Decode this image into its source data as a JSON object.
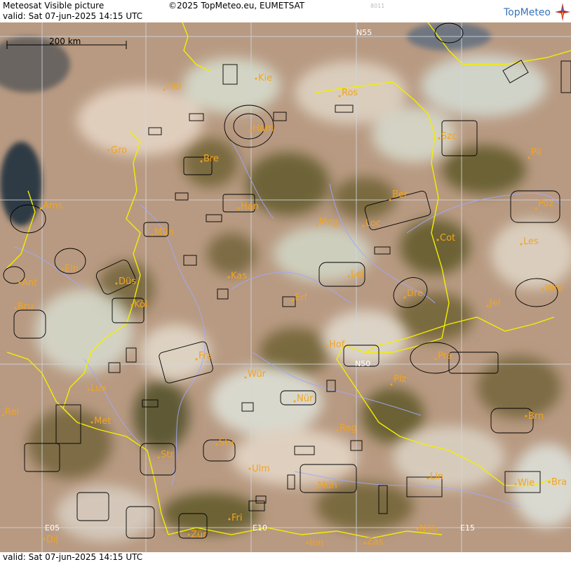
{
  "header": {
    "title": "Meteosat Visible picture",
    "copyright": "©2025 TopMeteo.eu, EUMETSAT",
    "code": "8011",
    "valid": "valid:  Sat  07-jun-2025  14:15 UTC",
    "logo_text": "TopMeteo"
  },
  "footer": {
    "valid": "valid:  Sat  07-jun-2025  14:15 UTC"
  },
  "scale": {
    "label": "200 km"
  },
  "grid_labels": {
    "n55": "N55",
    "n50": "N50",
    "e05": "E05",
    "e10": "E10",
    "e15": "E15"
  },
  "cities": {
    "kie": "Kie",
    "hel": "Hel",
    "ros": "Ros",
    "ham": "Ham",
    "szc": "Szc",
    "gro": "Gro",
    "bre": "Bre",
    "pil": "Pil",
    "ber": "Ber",
    "han": "Han",
    "poz": "Poz",
    "ams": "Ams",
    "mag": "Mag",
    "loc": "Loc",
    "mun": "Mün",
    "cot": "Cot",
    "les": "Les",
    "ein": "Ein",
    "lei": "Lei",
    "kas": "Kas",
    "dus": "Düs",
    "ant": "Ant",
    "wro": "Wro",
    "dre": "Dre",
    "kol": "Köl",
    "bru": "Bru",
    "erf": "Erf",
    "jel": "Jel",
    "hof": "Hof",
    "fra": "Fra",
    "pra": "Pra",
    "wur": "Wür",
    "plz": "Plz",
    "lux": "Lux",
    "nur": "Nür",
    "rei": "Rei",
    "brn": "Brn",
    "met": "Met",
    "reg": "Reg",
    "stu": "Stu",
    "str": "Str",
    "lin": "Lin",
    "ulm": "Ulm",
    "mun2": "Mün",
    "wie": "Wie",
    "bra": "Bra",
    "fri": "Fri",
    "zur": "Zür",
    "nob": "Nöb",
    "dij": "Dij",
    "inn": "Inn",
    "zas": "Zas"
  },
  "colors": {
    "border": "#f2ee00",
    "city": "#f3a41e",
    "river": "#9ea9ff",
    "zone_outline": "#000000",
    "grid": "#cfd6e0",
    "logo": "#3a74b8"
  }
}
